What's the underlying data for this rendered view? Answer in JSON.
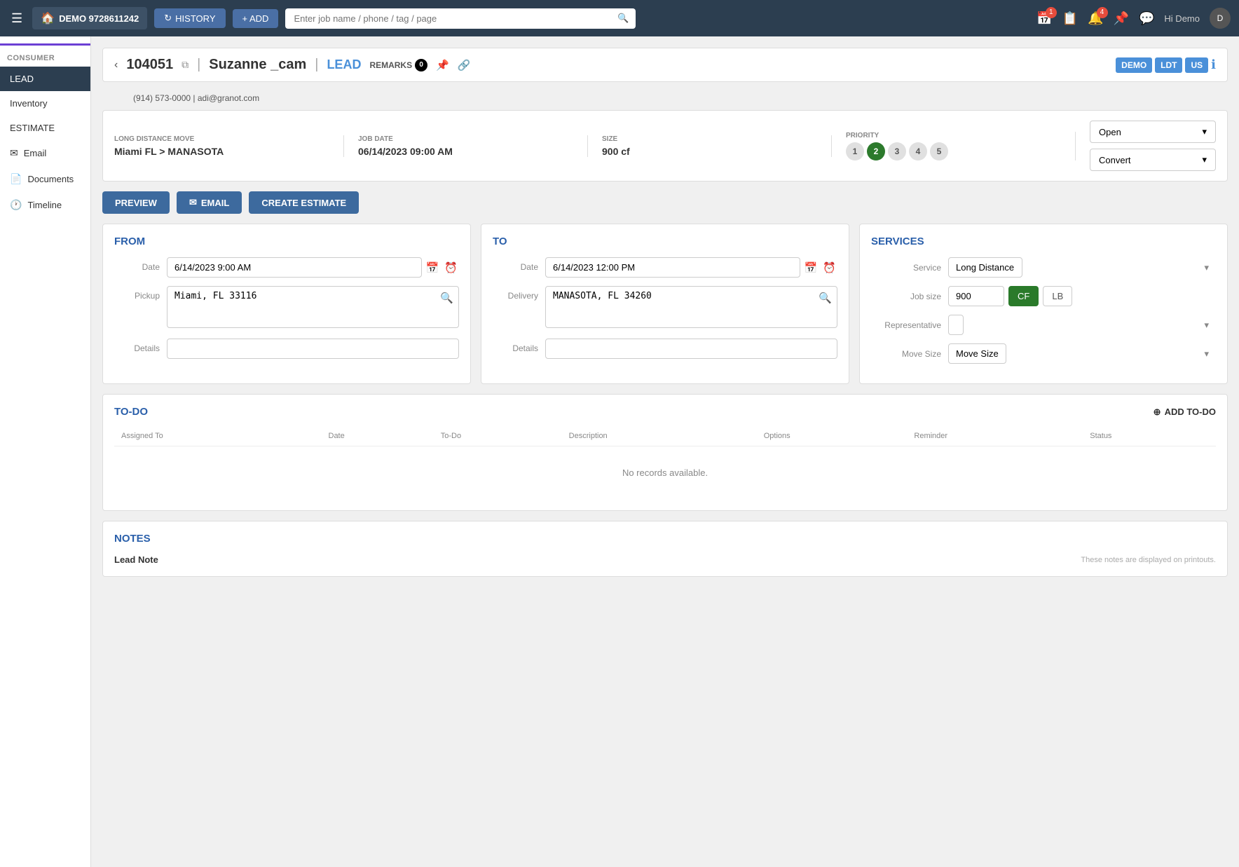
{
  "topnav": {
    "brand": "DEMO 9728611242",
    "history_label": "HISTORY",
    "add_label": "+ ADD",
    "search_placeholder": "Enter job name / phone / tag / page",
    "hi_user": "Hi Demo",
    "badge_calendar": "1",
    "badge_tasks": "4"
  },
  "sidebar": {
    "section_label": "CONSUMER",
    "items": [
      {
        "label": "LEAD",
        "active": true
      },
      {
        "label": "Inventory",
        "active": false
      },
      {
        "label": "ESTIMATE",
        "active": false
      },
      {
        "label": "Email",
        "active": false
      },
      {
        "label": "Documents",
        "active": false
      },
      {
        "label": "Timeline",
        "active": false
      }
    ]
  },
  "header": {
    "job_id": "104051",
    "client_name": "Suzanne _cam",
    "lead_label": "LEAD",
    "remarks_label": "REMARKS",
    "remarks_count": "0",
    "phone": "(914) 573-0000",
    "email": "adi@granot.com",
    "badge_demo": "DEMO",
    "badge_ldt": "LDT",
    "badge_us": "US"
  },
  "info_card": {
    "move_type_label": "LONG DISTANCE MOVE",
    "move_route": "Miami FL > MANASOTA",
    "job_date_label": "JOB DATE",
    "job_date": "06/14/2023 09:00 AM",
    "size_label": "SIZE",
    "size_value": "900 cf",
    "priority_label": "PRIORITY",
    "priority_options": [
      "1",
      "2",
      "3",
      "4",
      "5"
    ],
    "priority_active": 2,
    "status_label": "Open",
    "convert_label": "Convert"
  },
  "action_buttons": {
    "preview": "PREVIEW",
    "email": "EMAIL",
    "create_estimate": "CREATE ESTIMATE"
  },
  "from_panel": {
    "title": "FROM",
    "date_label": "Date",
    "date_value": "6/14/2023 9:00 AM",
    "pickup_label": "Pickup",
    "pickup_value": "Miami, FL 33116",
    "details_label": "Details"
  },
  "to_panel": {
    "title": "TO",
    "date_label": "Date",
    "date_value": "6/14/2023 12:00 PM",
    "delivery_label": "Delivery",
    "delivery_value": "MANASOTA, FL 34260",
    "details_label": "Details"
  },
  "services_panel": {
    "title": "SERVICES",
    "service_label": "Service",
    "service_value": "Long Distance",
    "jobsize_label": "Job size",
    "jobsize_value": "900",
    "unit_cf": "CF",
    "unit_lb": "LB",
    "representative_label": "Representative",
    "move_size_label": "Move Size",
    "move_size_value": "Move Size"
  },
  "todo": {
    "title": "TO-DO",
    "add_label": "ADD TO-DO",
    "columns": [
      "Assigned To",
      "Date",
      "To-Do",
      "Description",
      "Options",
      "Reminder",
      "Status"
    ],
    "no_records": "No records available."
  },
  "notes": {
    "title": "NOTES",
    "lead_note_label": "Lead Note",
    "hint": "These notes are displayed on printouts."
  }
}
